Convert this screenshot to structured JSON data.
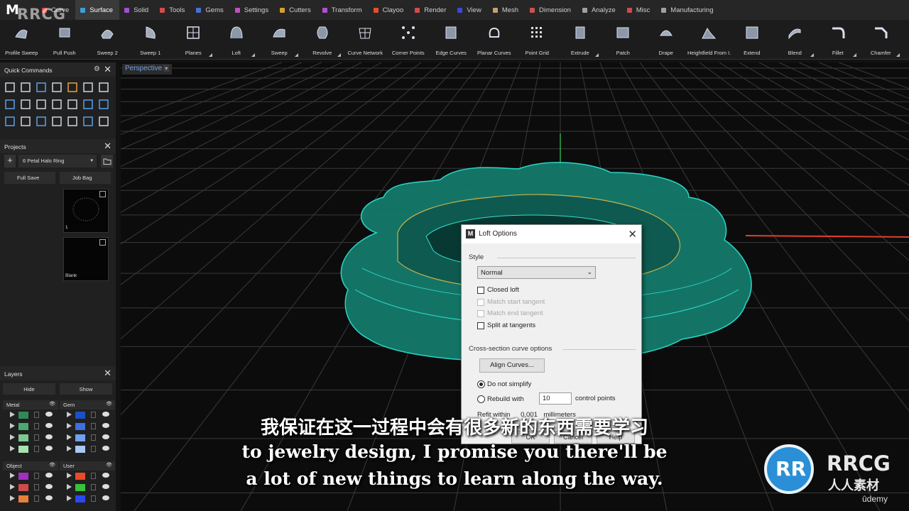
{
  "app": {
    "logo_glyph": "M"
  },
  "tabs": [
    {
      "label": "Curve",
      "color": "#e84a4a",
      "active": false
    },
    {
      "label": "Surface",
      "color": "#3aa0d8",
      "active": true
    },
    {
      "label": "Solid",
      "color": "#a050d0",
      "active": false
    },
    {
      "label": "Tools",
      "color": "#d84a4a",
      "active": false
    },
    {
      "label": "Gems",
      "color": "#4a70d8",
      "active": false
    },
    {
      "label": "Settings",
      "color": "#c050c0",
      "active": false
    },
    {
      "label": "Cutters",
      "color": "#d8a030",
      "active": false
    },
    {
      "label": "Transform",
      "color": "#b050d0",
      "active": false
    },
    {
      "label": "Clayoo",
      "color": "#e05030",
      "active": false
    },
    {
      "label": "Render",
      "color": "#d84a4a",
      "active": false
    },
    {
      "label": "View",
      "color": "#3a4ad8",
      "active": false
    },
    {
      "label": "Mesh",
      "color": "#c8a070",
      "active": false
    },
    {
      "label": "Dimension",
      "color": "#d05050",
      "active": false
    },
    {
      "label": "Analyze",
      "color": "#a0a0a0",
      "active": false
    },
    {
      "label": "Misc",
      "color": "#d04a4a",
      "active": false
    },
    {
      "label": "Manufacturing",
      "color": "#a0a0a0",
      "active": false
    }
  ],
  "ribbon_tools": [
    {
      "label": "Profile Sweep",
      "icon": "profile-sweep-icon",
      "menu": false
    },
    {
      "label": "Pull Push",
      "icon": "pull-push-icon",
      "menu": false
    },
    {
      "label": "Sweep 2",
      "icon": "sweep-2-icon",
      "menu": false
    },
    {
      "label": "Sweep 1",
      "icon": "sweep-1-icon",
      "menu": false
    },
    {
      "label": "Planes",
      "icon": "planes-icon",
      "menu": true
    },
    {
      "label": "Loft",
      "icon": "loft-icon",
      "menu": true
    },
    {
      "label": "Sweep",
      "icon": "sweep-icon",
      "menu": true
    },
    {
      "label": "Revolve",
      "icon": "revolve-icon",
      "menu": true
    },
    {
      "label": "Curve Network",
      "icon": "curve-network-icon",
      "menu": false
    },
    {
      "label": "Corner Points",
      "icon": "corner-points-icon",
      "menu": false
    },
    {
      "label": "Edge Curves",
      "icon": "edge-curves-icon",
      "menu": false
    },
    {
      "label": "Planar Curves",
      "icon": "planar-curves-icon",
      "menu": false
    },
    {
      "label": "Point Grid",
      "icon": "point-grid-icon",
      "menu": false
    },
    {
      "label": "Extrude",
      "icon": "extrude-icon",
      "menu": true
    },
    {
      "label": "Patch",
      "icon": "patch-icon",
      "menu": false
    },
    {
      "label": "Drape",
      "icon": "drape-icon",
      "menu": false
    },
    {
      "label": "Heightfield From I...",
      "icon": "heightfield-icon",
      "menu": false
    },
    {
      "label": "Extend",
      "icon": "extend-icon",
      "menu": false
    },
    {
      "label": "Blend",
      "icon": "blend-icon",
      "menu": true
    },
    {
      "label": "Fillet",
      "icon": "fillet-icon",
      "menu": true
    },
    {
      "label": "Chamfer",
      "icon": "chamfer-icon",
      "menu": true
    }
  ],
  "quick_commands": {
    "title": "Quick Commands"
  },
  "projects": {
    "title": "Projects",
    "selected": "6 Petal Halo Ring",
    "full_save": "Full Save",
    "job_bag": "Job Bag",
    "thumbs": [
      {
        "label": "1"
      },
      {
        "label": "Blank"
      }
    ]
  },
  "layers": {
    "title": "Layers",
    "hide": "Hide",
    "show": "Show",
    "groups": [
      {
        "name": "Metal",
        "colors": [
          "#2f8a5a",
          "#4aa870",
          "#7cc890",
          "#a8e0b0"
        ]
      },
      {
        "name": "Gem",
        "colors": [
          "#1a50c8",
          "#3a70e0",
          "#70a0f0",
          "#a8c8f8"
        ]
      },
      {
        "name": "Object",
        "colors": [
          "#a030c0",
          "#d04a4a",
          "#e8803a"
        ]
      },
      {
        "name": "User",
        "colors": [
          "#e84a2a",
          "#3ac03a",
          "#2a4af0"
        ]
      }
    ]
  },
  "viewport": {
    "label": "Perspective"
  },
  "dialog": {
    "title": "Loft Options",
    "style_group": "Style",
    "style_value": "Normal",
    "closed_loft": "Closed loft",
    "match_start": "Match start tangent",
    "match_end": "Match end tangent",
    "split_tangents": "Split at tangents",
    "cross_group": "Cross-section curve options",
    "align_curves": "Align Curves...",
    "do_not_simplify": "Do not simplify",
    "rebuild_with": "Rebuild with",
    "rebuild_value": "10",
    "control_points": "control points",
    "refit_within": "Refit within",
    "refit_value": "0.001",
    "refit_unit": "millimeters",
    "ok": "OK",
    "cancel": "Cancel",
    "help": "Help"
  },
  "subtitles": {
    "cn": "我保证在这一过程中会有很多新的东西需要学习",
    "en1": "to jewelry design, I promise you there'll be",
    "en2": "a lot of new things to learn along the way."
  },
  "watermark": {
    "top": "RRCG",
    "brand": "RRCG",
    "brand_cn": "人人素材",
    "udemy": "ûdemy"
  }
}
